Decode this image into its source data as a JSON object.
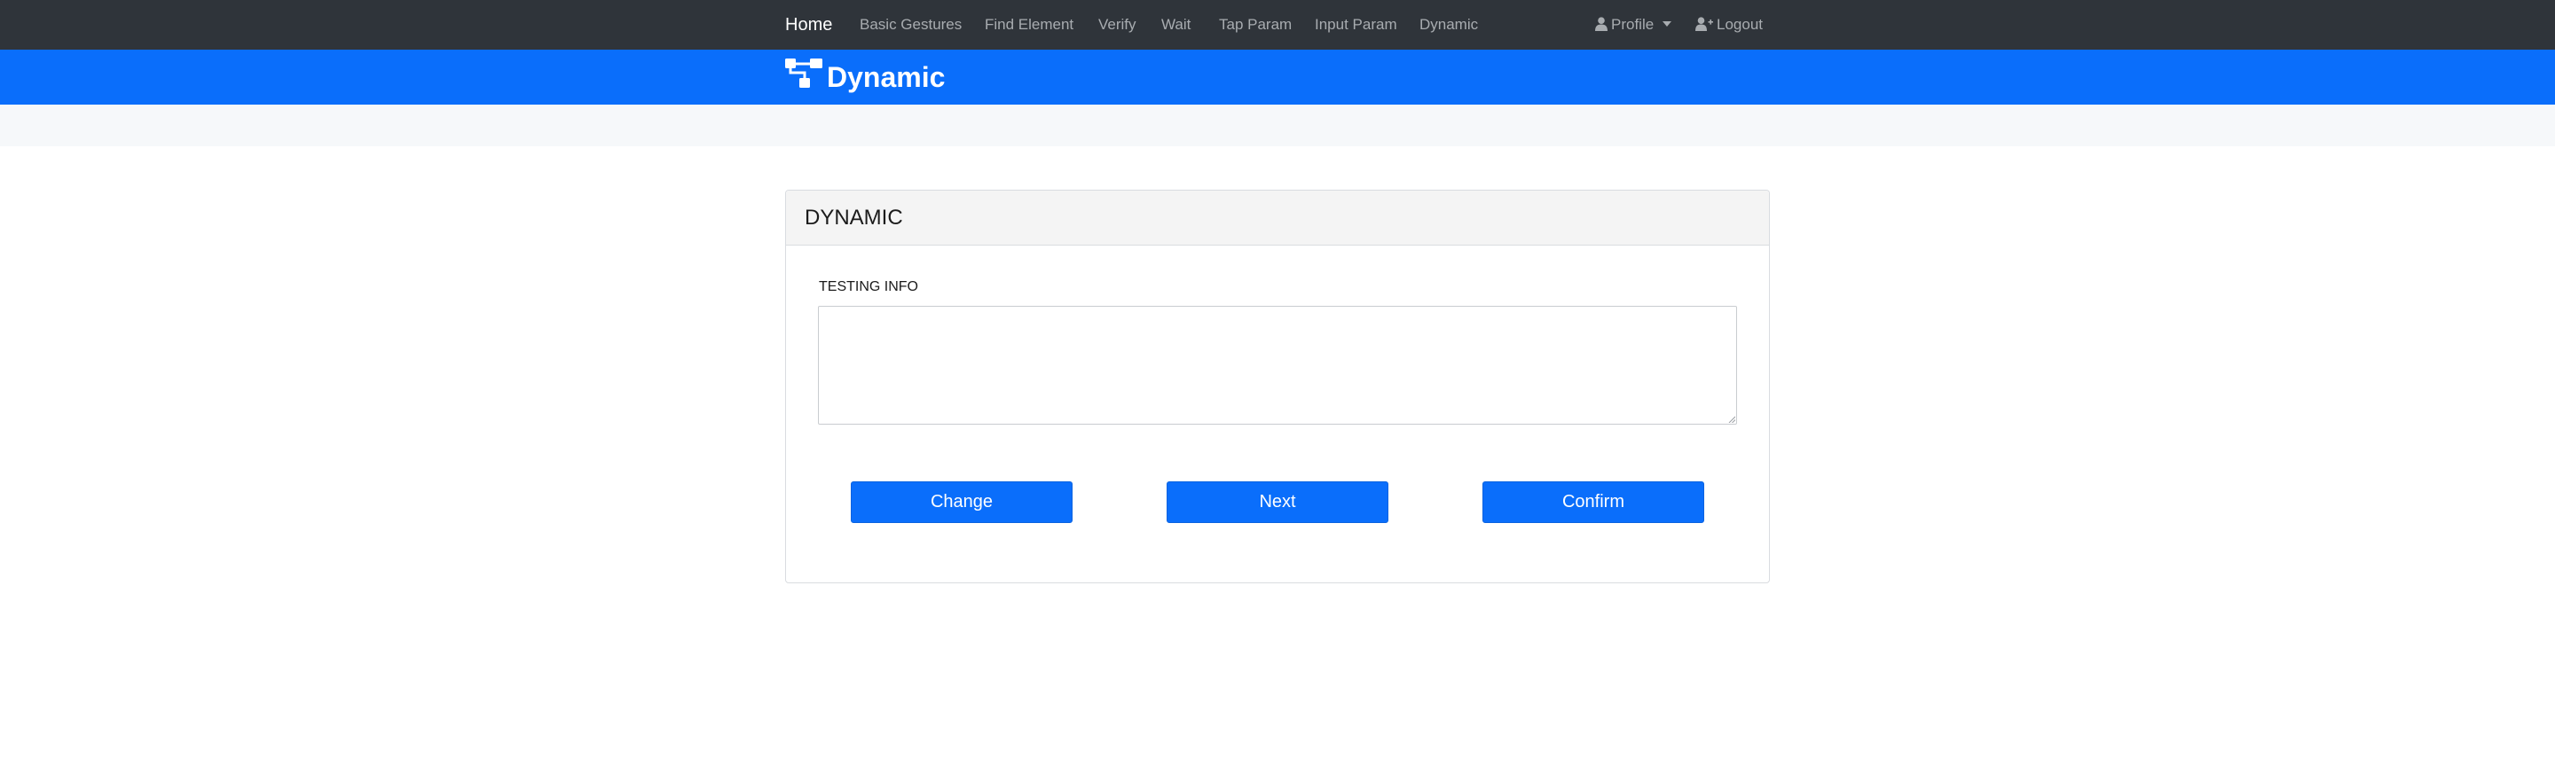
{
  "navbar": {
    "brand": "Home",
    "links": [
      "Basic Gestures",
      "Find Element",
      "Verify",
      "Wait",
      "Tap Param",
      "Input Param",
      "Dynamic"
    ],
    "profile_label": "Profile",
    "logout_label": "Logout"
  },
  "header": {
    "title": "Dynamic"
  },
  "card": {
    "title": "DYNAMIC",
    "field_label": "TESTING INFO",
    "textarea_value": "",
    "buttons": {
      "change": "Change",
      "next": "Next",
      "confirm": "Confirm"
    }
  },
  "colors": {
    "navbar_bg": "#2f343a",
    "primary": "#0a6efb",
    "band_bg": "#f6f8fa",
    "card_header_bg": "#f4f4f4"
  }
}
